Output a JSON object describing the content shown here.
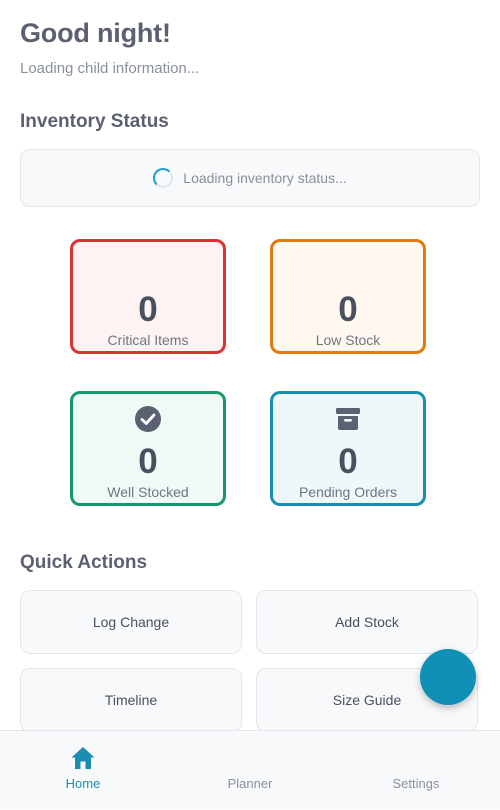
{
  "header": {
    "greeting": "Good night!",
    "subtitle": "Loading child information..."
  },
  "inventory": {
    "title": "Inventory Status",
    "loading_text": "Loading inventory status...",
    "cards": [
      {
        "value": "0",
        "label": "Critical Items",
        "color": "#dc3232"
      },
      {
        "value": "0",
        "label": "Low Stock",
        "color": "#e07b0f"
      },
      {
        "value": "0",
        "label": "Well Stocked",
        "color": "#159a66",
        "icon": "check-circle-icon"
      },
      {
        "value": "0",
        "label": "Pending Orders",
        "color": "#1a8eb0",
        "icon": "archive-box-icon"
      }
    ]
  },
  "quick_actions": {
    "title": "Quick Actions",
    "items": [
      {
        "label": "Log Change"
      },
      {
        "label": "Add Stock"
      },
      {
        "label": "Timeline"
      },
      {
        "label": "Size Guide"
      }
    ]
  },
  "fab": {
    "color": "#0f8fb6"
  },
  "nav": {
    "items": [
      {
        "label": "Home",
        "icon": "home-icon",
        "active": true
      },
      {
        "label": "Planner"
      },
      {
        "label": "Settings"
      }
    ],
    "active_color": "#1a8eb0"
  }
}
